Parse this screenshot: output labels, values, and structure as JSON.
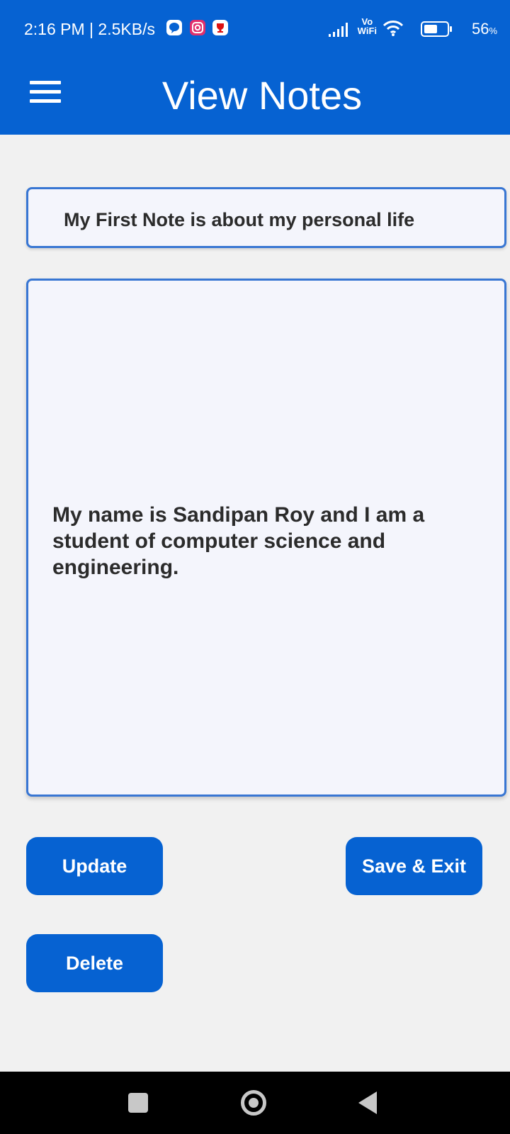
{
  "status_bar": {
    "time": "2:16 PM | 2.5KB/s",
    "vowifi_line1": "Vo",
    "vowifi_line2": "WiFi",
    "battery_percent": "56",
    "battery_unit": "%",
    "icons": [
      "chat-bubble-icon",
      "instagram-icon",
      "trophy-app-icon",
      "signal-icon",
      "vowifi-icon",
      "wifi-icon",
      "battery-icon"
    ]
  },
  "app_bar": {
    "title": "View Notes",
    "menu_icon": "hamburger-menu-icon",
    "color": "#0662d2"
  },
  "note": {
    "title": "My First Note is about my personal life",
    "body": "My name is Sandipan Roy and I am a student of computer science and engineering."
  },
  "buttons": {
    "update": "Update",
    "save_exit": "Save & Exit",
    "delete": "Delete"
  },
  "nav_bar": {
    "icons": [
      "recent-apps-icon",
      "home-icon",
      "back-icon"
    ]
  },
  "colors": {
    "primary": "#0662d2",
    "field_border": "#3876d3",
    "field_bg": "#f4f5fc",
    "page_bg": "#f1f1f1"
  }
}
